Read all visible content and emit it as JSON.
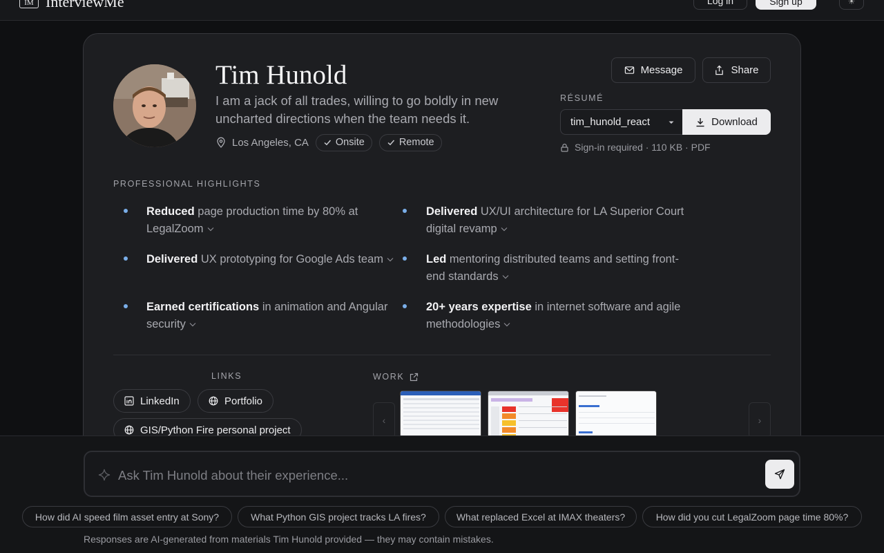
{
  "app": {
    "logo_mark": "IM",
    "name": "InterviewMe",
    "login_label": "Log in",
    "signup_label": "Sign up"
  },
  "profile": {
    "name": "Tim Hunold",
    "tagline": "I am a jack of all trades, willing to go boldly in new uncharted directions when the team needs it.",
    "location": "Los Angeles, CA",
    "chips": [
      "Onsite",
      "Remote"
    ],
    "message_label": "Message",
    "share_label": "Share"
  },
  "resume": {
    "label": "RÉSUMÉ",
    "selected_file": "tim_hunold_react",
    "download_label": "Download",
    "meta": "Sign-in required · 110 KB · PDF"
  },
  "highlights": {
    "title": "PROFESSIONAL HIGHLIGHTS",
    "items": [
      {
        "bold": "Reduced",
        "rest": " page production time by 80% at LegalZoom"
      },
      {
        "bold": "Delivered",
        "rest": " UX/UI architecture for LA Superior Court digital revamp"
      },
      {
        "bold": "Delivered",
        "rest": " UX prototyping for Google Ads team"
      },
      {
        "bold": "Led",
        "rest": " mentoring distributed teams and setting front-end standards"
      },
      {
        "bold": "Earned certifications",
        "rest": " in animation and Angular security"
      },
      {
        "bold": "20+ years expertise",
        "rest": " in internet software and agile methodologies"
      }
    ]
  },
  "links": {
    "title": "LINKS",
    "items": [
      "LinkedIn",
      "Portfolio",
      "GIS/Python Fire personal project"
    ]
  },
  "work": {
    "title": "WORK"
  },
  "chat": {
    "placeholder": "Ask Tim Hunold about their experience...",
    "suggestions": [
      "How did AI speed film asset entry at Sony?",
      "What Python GIS project tracks LA fires?",
      "What replaced Excel at IMAX theaters?",
      "How did you cut LegalZoom page time 80%?"
    ],
    "disclaimer": "Responses are AI-generated from materials Tim Hunold provided — they may contain mistakes."
  },
  "colors": {
    "background": "#0f1012",
    "card": "#1d1e21",
    "accent_dot": "#7aaee8",
    "primary_button": "#ececee"
  }
}
